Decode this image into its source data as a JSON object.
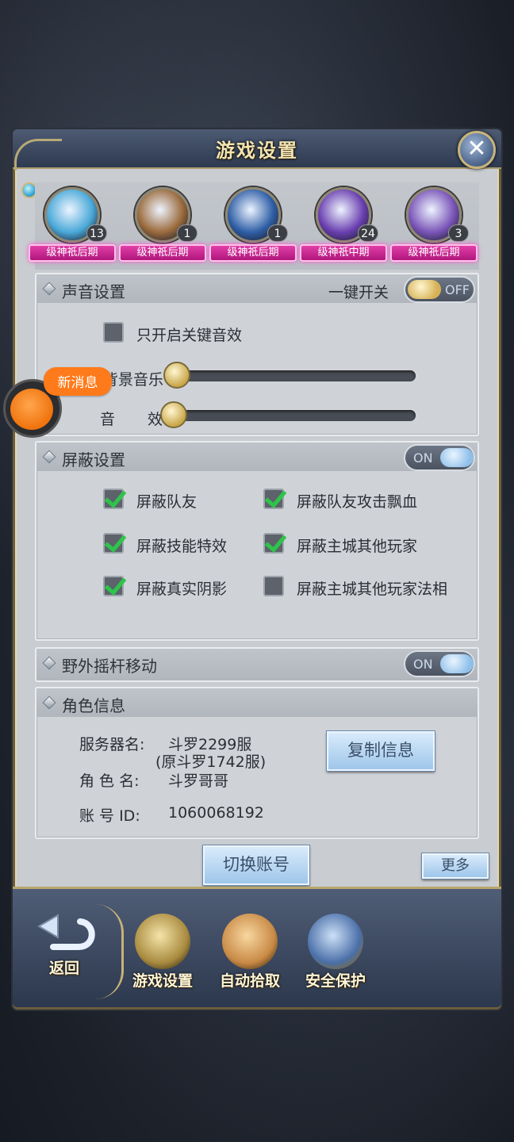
{
  "title": "游戏设置",
  "close_label": "✕",
  "heroes": [
    {
      "count": "13",
      "rank": "级神祇后期",
      "color": "#4aa9d8"
    },
    {
      "count": "1",
      "rank": "级神祇后期",
      "color": "#9a6a3c"
    },
    {
      "count": "1",
      "rank": "级神祇后期",
      "color": "#2f5fa6"
    },
    {
      "count": "24",
      "rank": "级神祇中期",
      "color": "#6a3fb0"
    },
    {
      "count": "3",
      "rank": "级神祇后期",
      "color": "#7a55b8"
    }
  ],
  "sound": {
    "title": "声音设置",
    "master_label": "一键开关",
    "master_state": "OFF",
    "key_sound_only": "只开启关键音效",
    "music_label": "背景音乐",
    "sfx_label_1": "音",
    "sfx_label_2": "效",
    "music_level": 0,
    "sfx_level": 0
  },
  "block": {
    "title": "屏蔽设置",
    "state": "ON",
    "items": [
      {
        "label": "屏蔽队友",
        "checked": true
      },
      {
        "label": "屏蔽队友攻击飘血",
        "checked": true
      },
      {
        "label": "屏蔽技能特效",
        "checked": true
      },
      {
        "label": "屏蔽主城其他玩家",
        "checked": true
      },
      {
        "label": "屏蔽真实阴影",
        "checked": true
      },
      {
        "label": "屏蔽主城其他玩家法相",
        "checked": false
      }
    ]
  },
  "joystick": {
    "title": "野外摇杆移动",
    "state": "ON"
  },
  "role": {
    "title": "角色信息",
    "server_label": "服务器名:",
    "server_value": "斗罗2299服",
    "server_original": "(原斗罗1742服)",
    "role_label": "角 色 名:",
    "role_value": "斗罗哥哥",
    "account_label": "账 号 ID:",
    "account_value": "1060068192",
    "copy_button": "复制信息"
  },
  "switch_account": "切换账号",
  "more": "更多",
  "chat_badge": "新消息",
  "bottom_nav": {
    "back": "返回",
    "items": [
      "游戏设置",
      "自动拾取",
      "安全保护"
    ]
  }
}
